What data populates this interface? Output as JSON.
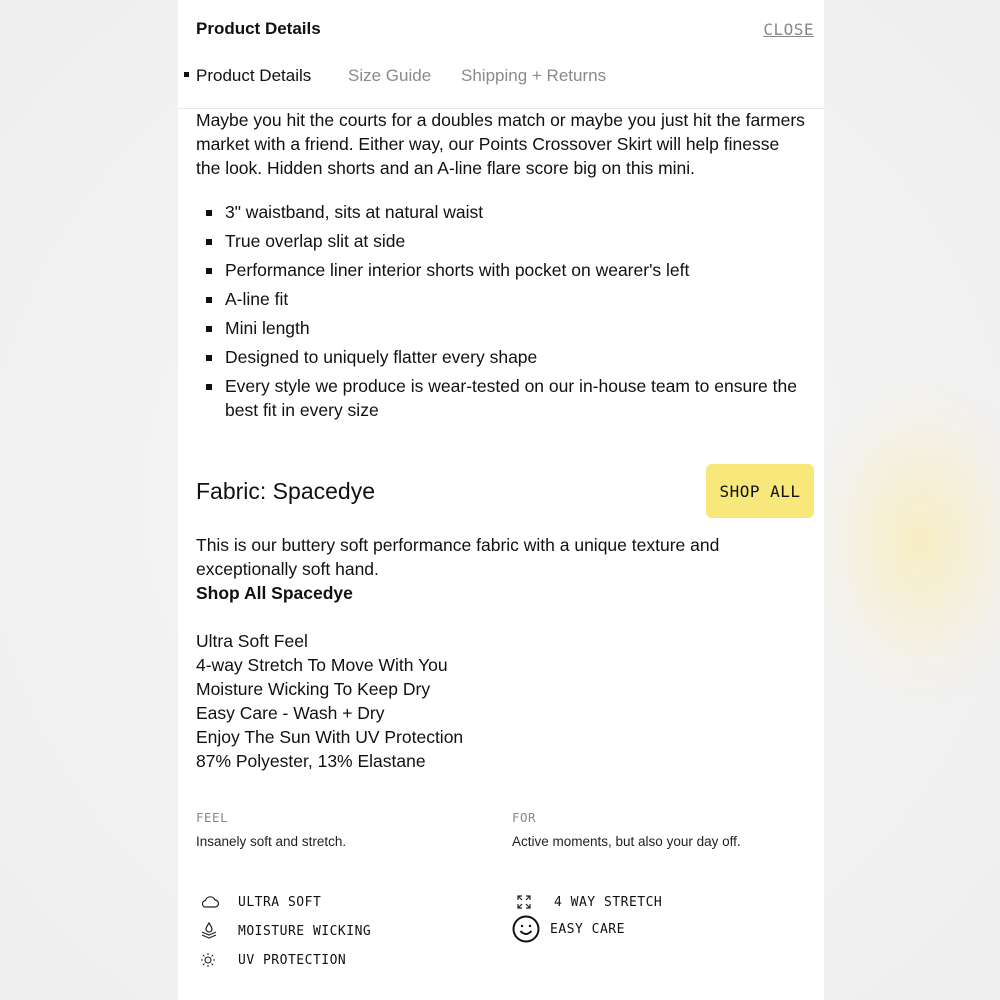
{
  "header": {
    "title": "Product Details",
    "close_label": "CLOSE"
  },
  "tabs": [
    {
      "label": "Product Details",
      "active": true
    },
    {
      "label": "Size Guide",
      "active": false
    },
    {
      "label": "Shipping + Returns",
      "active": false
    }
  ],
  "description": {
    "intro": "Maybe you hit the courts for a doubles match or maybe you just hit the farmers market with a friend. Either way, our Points Crossover Skirt will help finesse the look. Hidden shorts and an A-line flare score big on this mini.",
    "features": [
      "3\" waistband, sits at natural waist",
      "True overlap slit at side",
      "Performance liner interior shorts with pocket on wearer's left",
      "A-line fit",
      "Mini length",
      "Designed to uniquely flatter every shape",
      "Every style we produce is wear-tested on our in-house team to ensure the best fit in every size"
    ]
  },
  "fabric": {
    "title": "Fabric: Spacedye",
    "shop_all_label": "SHOP ALL",
    "description": "This is our buttery soft performance fabric with a unique texture and exceptionally soft hand.",
    "shop_link": "Shop All Spacedye",
    "properties": [
      "Ultra Soft Feel",
      "4-way Stretch To Move With You",
      "Moisture Wicking To Keep Dry",
      "Easy Care - Wash + Dry",
      "Enjoy The Sun With UV Protection",
      "87% Polyester, 13% Elastane"
    ]
  },
  "meta": {
    "feel_label": "FEEL",
    "feel_value": "Insanely soft and stretch.",
    "for_label": "FOR",
    "for_value": "Active moments, but also your day off."
  },
  "attributes": [
    {
      "icon": "cloud-icon",
      "label": "ULTRA SOFT"
    },
    {
      "icon": "expand-arrows-icon",
      "label": "4 WAY STRETCH"
    },
    {
      "icon": "droplet-layers-icon",
      "label": "MOISTURE WICKING"
    },
    {
      "icon": "smiley-icon",
      "label": "EASY CARE"
    },
    {
      "icon": "sun-icon",
      "label": "UV PROTECTION"
    }
  ],
  "colors": {
    "accent": "#f8e77a",
    "muted": "#8a8a8a",
    "text": "#111111"
  }
}
